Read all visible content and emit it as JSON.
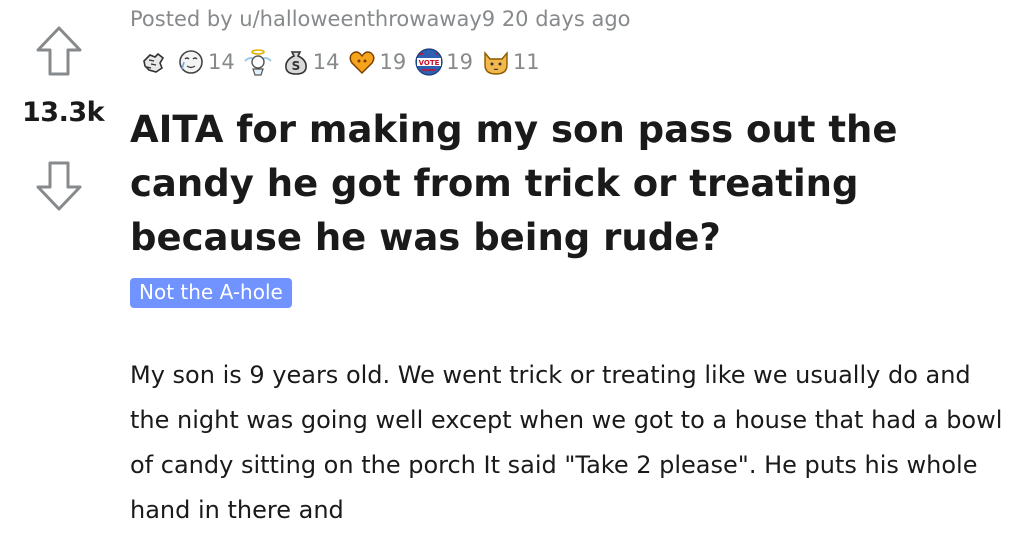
{
  "vote": {
    "score": "13.3k"
  },
  "post": {
    "meta": "Posted by u/halloweenthrowaway9 20 days ago",
    "awards": [
      {
        "icon": "fist-bump-award-icon",
        "count": ""
      },
      {
        "icon": "crying-face-award-icon",
        "count": "14"
      },
      {
        "icon": "angel-award-icon",
        "count": ""
      },
      {
        "icon": "money-bag-award-icon",
        "count": "14"
      },
      {
        "icon": "heart-hug-award-icon",
        "count": "19"
      },
      {
        "icon": "vote-badge-award-icon",
        "count": "19"
      },
      {
        "icon": "doge-award-icon",
        "count": "11"
      }
    ],
    "title": "AITA for making my son pass out the candy he got from trick or treating because he was being rude?",
    "flair": "Not the A-hole",
    "flair_color": "#7193ff",
    "body": "My son is 9 years old. We went trick or treating like we usually do and the night was going well except when we got to a house that had a bowl of candy sitting on the porch It said \"Take 2 please\". He puts his whole hand in there and"
  },
  "colors": {
    "meta": "#878a8c",
    "text": "#1a1a1b",
    "arrow": "#878a8c"
  }
}
